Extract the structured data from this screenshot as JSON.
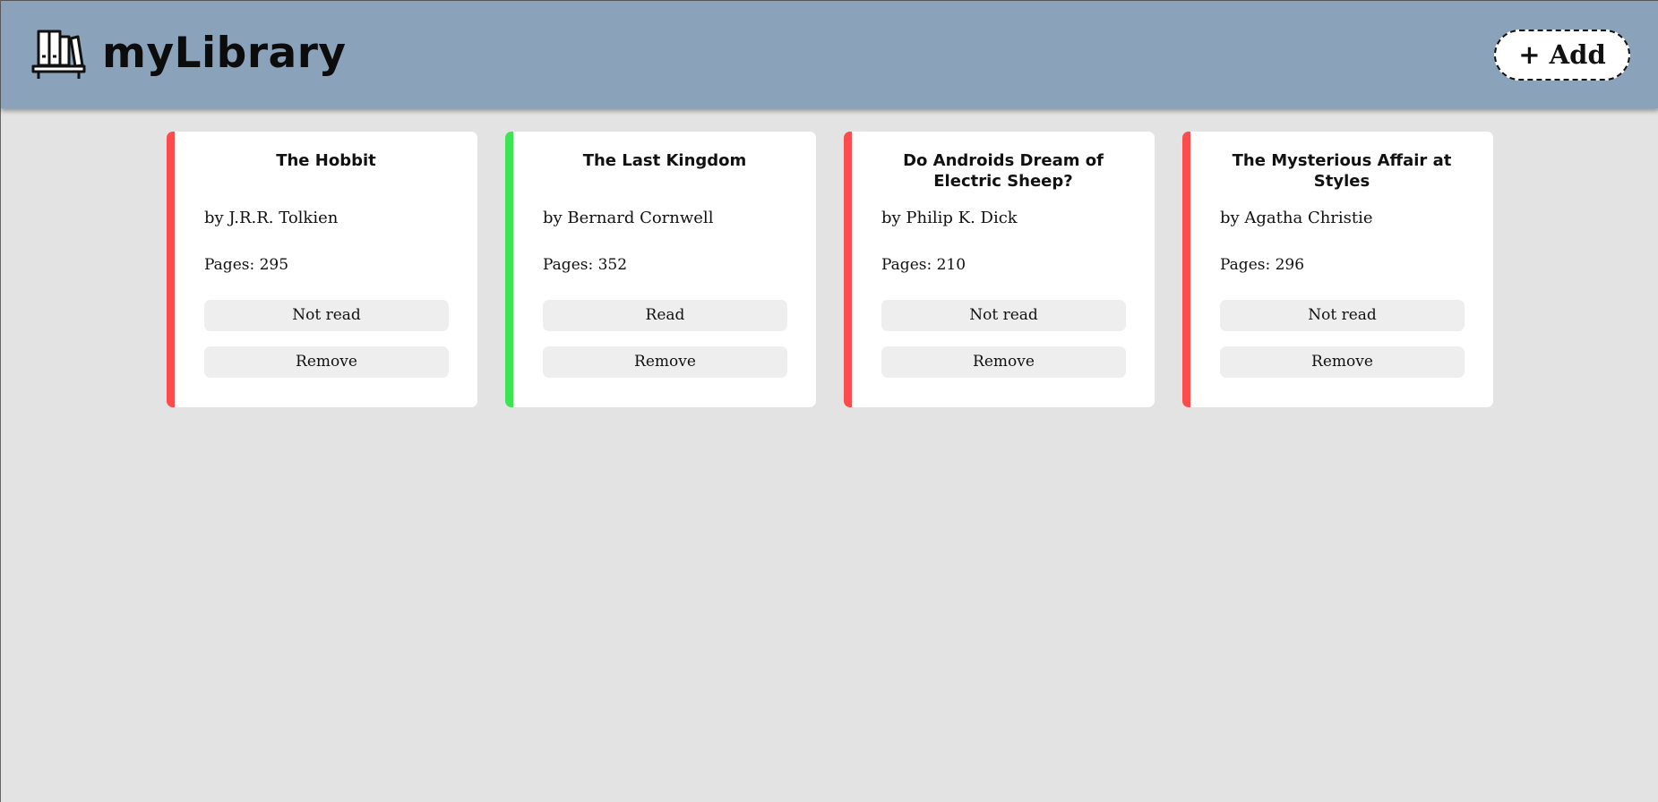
{
  "header": {
    "title": "myLibrary",
    "logo_icon": "bookshelf-icon",
    "add_button_label": "+ Add"
  },
  "colors": {
    "header_bg": "#8ba3ba",
    "page_bg": "#e3e3e3",
    "not_read_accent": "#ff4b4b",
    "read_accent": "#3ce653"
  },
  "books": [
    {
      "title": "The Hobbit",
      "author": "by J.R.R. Tolkien",
      "pages": "Pages: 295",
      "status_label": "Not read",
      "remove_label": "Remove"
    },
    {
      "title": "The Last Kingdom",
      "author": "by Bernard Cornwell",
      "pages": "Pages: 352",
      "status_label": "Read",
      "remove_label": "Remove"
    },
    {
      "title": "Do Androids Dream of Electric Sheep?",
      "author": "by Philip K. Dick",
      "pages": "Pages: 210",
      "status_label": "Not read",
      "remove_label": "Remove"
    },
    {
      "title": "The Mysterious Affair at Styles",
      "author": "by Agatha Christie",
      "pages": "Pages: 296",
      "status_label": "Not read",
      "remove_label": "Remove"
    }
  ]
}
